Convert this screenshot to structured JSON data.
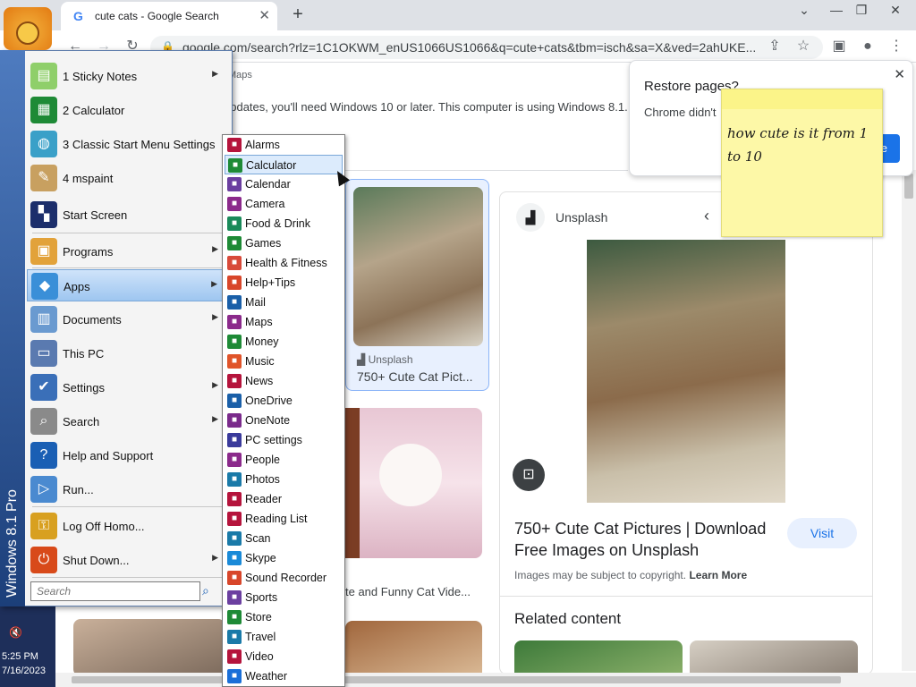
{
  "browser": {
    "tab_title": "cute cats - Google Search",
    "tab_favicon": "G",
    "new_tab": "+",
    "url": "google.com/search?rlz=1C1OKWM_enUS1066US1066&q=cute+cats&tbm=isch&sa=X&ved=2ahUKE...",
    "window_controls": {
      "dropdown": "⌄",
      "minimize": "—",
      "restore": "❐",
      "close": "✕"
    }
  },
  "page": {
    "nav_fragment": "Maps",
    "update_notice": "updates, you'll need Windows 10 or later. This computer is using Windows 8.1.",
    "results": [
      {
        "source": "Unsplash",
        "title": "750+ Cute Cat Pict..."
      }
    ],
    "video_title": "te and Funny Cat Vide...",
    "panel": {
      "source": "Unsplash",
      "title": "750+ Cute Cat Pictures | Download Free Images on Unsplash",
      "visit": "Visit",
      "copyright": "Images may be subject to copyright.",
      "learn_more": "Learn More",
      "related": "Related content"
    }
  },
  "restore_popup": {
    "heading": "Restore pages?",
    "body": "Chrome didn't",
    "button": "e",
    "close": "✕"
  },
  "sticky_note": {
    "text": "how cute is it from 1 to 10"
  },
  "start_menu": {
    "brand": "Windows 8.1 Pro",
    "items": [
      {
        "label": "1 Sticky Notes",
        "arrow": true,
        "icon": "sticky-notes-icon",
        "color": "#8fcf6a"
      },
      {
        "label": "2 Calculator",
        "arrow": false,
        "icon": "calculator-icon",
        "color": "#1e8a36"
      },
      {
        "label": "3 Classic Start Menu Settings",
        "arrow": false,
        "icon": "shell-icon",
        "color": "#3aa0c8"
      },
      {
        "label": "4 mspaint",
        "arrow": false,
        "icon": "palette-icon",
        "color": "#c8a060"
      },
      {
        "label": "Start Screen",
        "arrow": false,
        "icon": "start-screen-icon",
        "color": "#1c2e6b"
      },
      {
        "label": "Programs",
        "arrow": true,
        "icon": "programs-icon",
        "color": "#e2a23a"
      },
      {
        "label": "Apps",
        "arrow": true,
        "icon": "apps-icon",
        "color": "#3a8fd8"
      },
      {
        "label": "Documents",
        "arrow": true,
        "icon": "documents-icon",
        "color": "#6a9ad0"
      },
      {
        "label": "This PC",
        "arrow": false,
        "icon": "computer-icon",
        "color": "#5a7ab0"
      },
      {
        "label": "Settings",
        "arrow": true,
        "icon": "settings-icon",
        "color": "#3a6fb8"
      },
      {
        "label": "Search",
        "arrow": true,
        "icon": "search-icon",
        "color": "#8a8a8a"
      },
      {
        "label": "Help and Support",
        "arrow": false,
        "icon": "help-icon",
        "color": "#1a5fb4"
      },
      {
        "label": "Run...",
        "arrow": false,
        "icon": "run-icon",
        "color": "#4a8ad0"
      },
      {
        "label": "Log Off Homo...",
        "arrow": false,
        "icon": "log-off-icon",
        "color": "#d8a020"
      },
      {
        "label": "Shut Down...",
        "arrow": true,
        "icon": "shut-down-icon",
        "color": "#d84a1a"
      }
    ],
    "search_placeholder": "Search"
  },
  "apps_menu": {
    "items": [
      {
        "label": "Alarms",
        "color": "#b5143c"
      },
      {
        "label": "Calculator",
        "color": "#1e8a36"
      },
      {
        "label": "Calendar",
        "color": "#6b3fa0"
      },
      {
        "label": "Camera",
        "color": "#8b2a8b"
      },
      {
        "label": "Food & Drink",
        "color": "#1a8a5a"
      },
      {
        "label": "Games",
        "color": "#1e8a36"
      },
      {
        "label": "Health & Fitness",
        "color": "#d84a3a"
      },
      {
        "label": "Help+Tips",
        "color": "#d8462a"
      },
      {
        "label": "Mail",
        "color": "#1a5fa8"
      },
      {
        "label": "Maps",
        "color": "#8b2a8b"
      },
      {
        "label": "Money",
        "color": "#1e8a36"
      },
      {
        "label": "Music",
        "color": "#e0542a"
      },
      {
        "label": "News",
        "color": "#b5143c"
      },
      {
        "label": "OneDrive",
        "color": "#1a5fa8"
      },
      {
        "label": "OneNote",
        "color": "#7a2a8b"
      },
      {
        "label": "PC settings",
        "color": "#3a3a9b"
      },
      {
        "label": "People",
        "color": "#8b2a8b"
      },
      {
        "label": "Photos",
        "color": "#1a7aa8"
      },
      {
        "label": "Reader",
        "color": "#b5143c"
      },
      {
        "label": "Reading List",
        "color": "#b5143c"
      },
      {
        "label": "Scan",
        "color": "#1a7aa8"
      },
      {
        "label": "Skype",
        "color": "#1a8ad8"
      },
      {
        "label": "Sound Recorder",
        "color": "#d8462a"
      },
      {
        "label": "Sports",
        "color": "#6b3fa0"
      },
      {
        "label": "Store",
        "color": "#1e8a36"
      },
      {
        "label": "Travel",
        "color": "#1a7aa8"
      },
      {
        "label": "Video",
        "color": "#b5143c"
      },
      {
        "label": "Weather",
        "color": "#1a6fd8"
      }
    ],
    "selected": "Calculator"
  },
  "desktop": {
    "time": "5:25 PM",
    "date": "7/16/2023"
  }
}
